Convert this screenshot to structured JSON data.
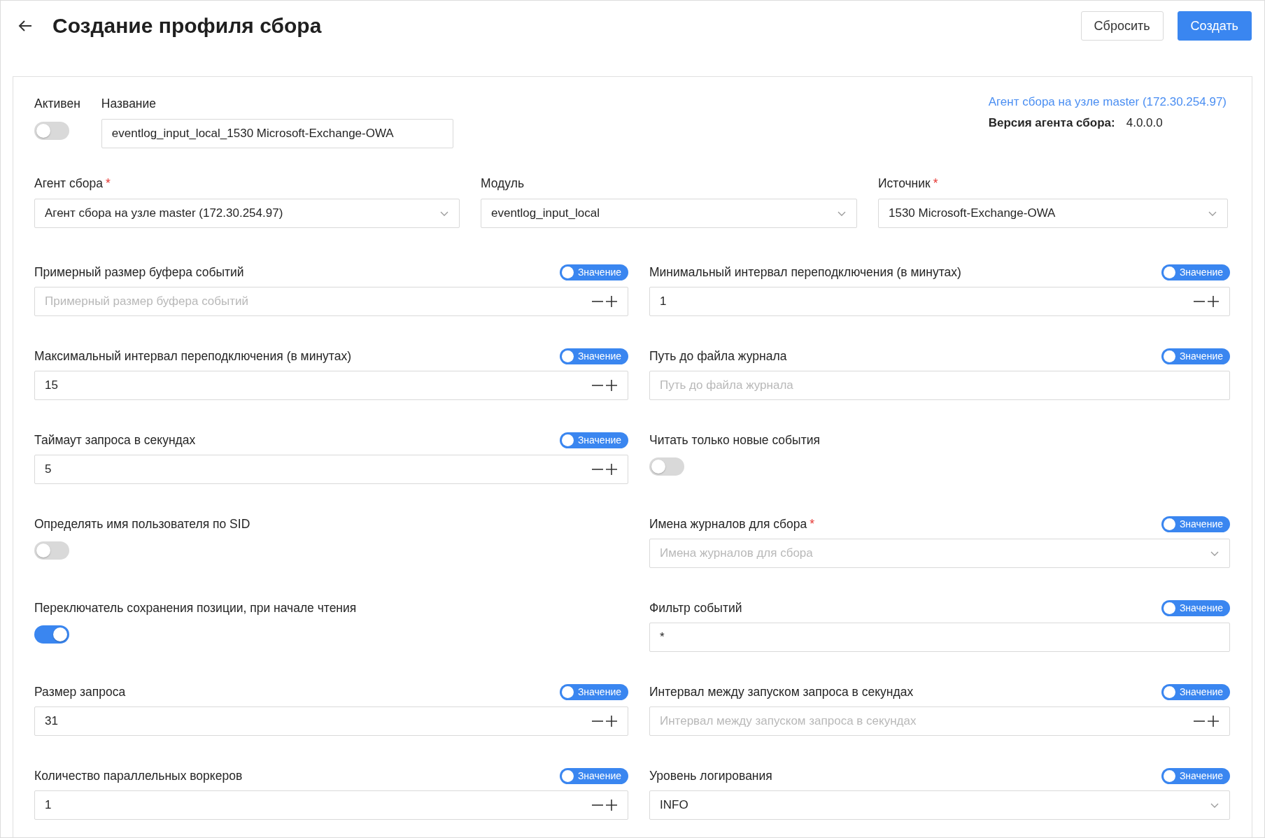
{
  "header": {
    "back_icon": true,
    "title": "Создание профиля сбора",
    "buttons": [
      {
        "label": "Сбросить",
        "kind": "secondary"
      },
      {
        "label": "Создать",
        "kind": "primary"
      }
    ]
  },
  "top": {
    "active": {
      "label": "Активен",
      "on": false
    },
    "name": {
      "label": "Название",
      "value": "eventlog_input_local_1530 Microsoft-Exchange-OWA"
    },
    "agent_link": "Агент сбора на узле master (172.30.254.97)",
    "agent_version": {
      "label": "Версия агента сбора:",
      "value": "4.0.0.0"
    }
  },
  "selects": [
    {
      "label": "Агент сбора",
      "required": true,
      "value": "Агент сбора на узле master (172.30.254.97)"
    },
    {
      "label": "Модуль",
      "required": false,
      "value": "eventlog_input_local"
    },
    {
      "label": "Источник",
      "required": true,
      "value": "1530 Microsoft-Exchange-OWA"
    }
  ],
  "fields": [
    {
      "kind": "number",
      "label": "Примерный размер буфера событий",
      "required": false,
      "placeholder": "Примерный размер буфера событий",
      "switch": {
        "label": "Значение",
        "on": true
      }
    },
    {
      "kind": "number",
      "label": "Минимальный интервал переподключения (в минутах)",
      "required": false,
      "value": "1",
      "switch": {
        "label": "Значение",
        "on": true
      }
    },
    {
      "kind": "number",
      "label": "Максимальный интервал переподключения (в минутах)",
      "required": false,
      "value": "15",
      "switch": {
        "label": "Значение",
        "on": true
      }
    },
    {
      "kind": "text",
      "label": "Путь до файла журнала",
      "required": false,
      "placeholder": "Путь до файла журнала",
      "switch": {
        "label": "Значение",
        "on": true
      }
    },
    {
      "kind": "number",
      "label": "Таймаут запроса в секундах",
      "required": false,
      "value": "5",
      "switch": {
        "label": "Значение",
        "on": true
      }
    },
    {
      "kind": "toggle",
      "label": "Читать только новые события",
      "required": false,
      "on": false
    },
    {
      "kind": "toggle",
      "label": "Определять имя пользователя по SID",
      "required": false,
      "on": false
    },
    {
      "kind": "select",
      "label": "Имена журналов для сбора",
      "required": true,
      "placeholder": "Имена журналов для сбора",
      "switch": {
        "label": "Значение",
        "on": true
      }
    },
    {
      "kind": "toggle",
      "label": "Переключатель сохранения позиции, при начале чтения",
      "required": false,
      "on": true
    },
    {
      "kind": "text",
      "label": "Фильтр событий",
      "required": false,
      "value": "*",
      "switch": {
        "label": "Значение",
        "on": true
      }
    },
    {
      "kind": "number",
      "label": "Размер запроса",
      "required": false,
      "value": "31",
      "switch": {
        "label": "Значение",
        "on": true
      }
    },
    {
      "kind": "number",
      "label": "Интервал между запуском запроса в секундах",
      "required": false,
      "placeholder": "Интервал между запуском запроса в секундах",
      "switch": {
        "label": "Значение",
        "on": true
      }
    },
    {
      "kind": "number",
      "label": "Количество параллельных воркеров",
      "required": false,
      "value": "1",
      "switch": {
        "label": "Значение",
        "on": true
      }
    },
    {
      "kind": "select",
      "label": "Уровень логирования",
      "required": false,
      "value": "INFO",
      "switch": {
        "label": "Значение",
        "on": true
      }
    }
  ]
}
